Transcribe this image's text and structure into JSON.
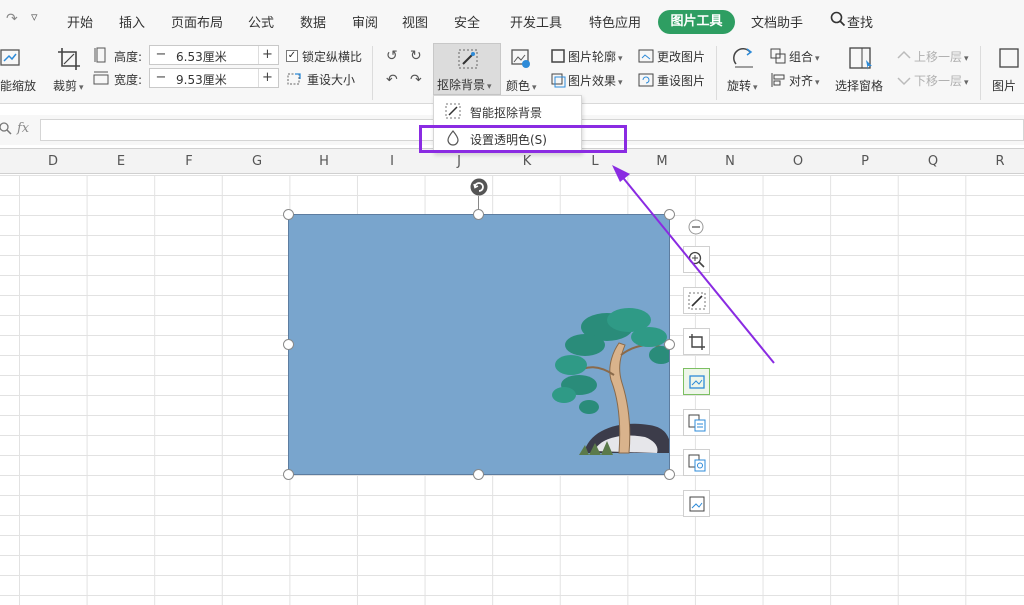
{
  "menubar": {
    "items": [
      "开始",
      "插入",
      "页面布局",
      "公式",
      "数据",
      "审阅",
      "视图",
      "安全",
      "开发工具",
      "特色应用",
      "图片工具",
      "文档助手",
      "查找"
    ],
    "active": "图片工具"
  },
  "ribbon": {
    "smart_zoom": "能缩放",
    "crop": "裁剪",
    "height_label": "高度:",
    "height_value": "6.53厘米",
    "width_label": "宽度:",
    "width_value": "9.53厘米",
    "lock_ratio": "锁定纵横比",
    "reset_size": "重设大小",
    "remove_bg": "抠除背景",
    "color": "颜色",
    "outline": "图片轮廓",
    "effects": "图片效果",
    "change_pic": "更改图片",
    "reset_pic": "重设图片",
    "rotate": "旋转",
    "group": "组合",
    "align": "对齐",
    "selection_pane": "选择窗格",
    "move_up": "上移一层",
    "move_down": "下移一层",
    "picture": "图片",
    "minus": "−",
    "plus": "+"
  },
  "dropdown": {
    "items": [
      "智能抠除背景",
      "设置透明色(S)"
    ]
  },
  "formula": {
    "fx": "fx"
  },
  "columns": [
    "D",
    "E",
    "F",
    "G",
    "H",
    "I",
    "J",
    "K",
    "L",
    "M",
    "N",
    "O",
    "P",
    "Q",
    "R"
  ],
  "colors": {
    "accent": "#2e9e62",
    "highlight": "#8a2be2",
    "picture_bg": "#79a5cd"
  }
}
